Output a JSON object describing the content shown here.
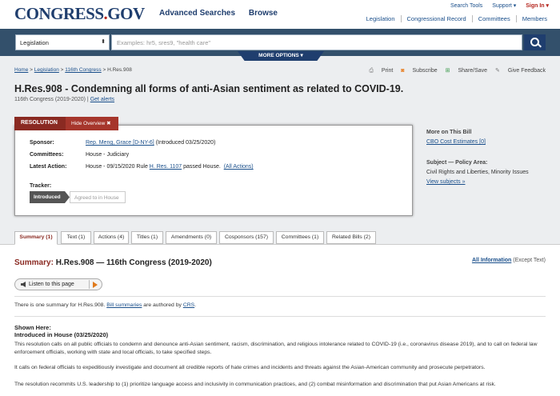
{
  "header": {
    "logo_main": "CONGRESS",
    "logo_dot": ".",
    "logo_gov": "GOV",
    "nav": [
      "Advanced Searches",
      "Browse"
    ],
    "util": [
      "Search Tools",
      "Support ▾",
      "Sign In ▾"
    ],
    "subnav": [
      "Legislation",
      "Congressional Record",
      "Committees",
      "Members"
    ]
  },
  "search": {
    "collection": "Legislation",
    "placeholder": "Examples: hr5, sres9, \"health care\"",
    "more_options": "MORE OPTIONS ▾"
  },
  "breadcrumb": {
    "items": [
      "Home",
      "Legislation",
      "116th Congress"
    ],
    "sep": " > ",
    "current": "H.Res.908"
  },
  "tools": [
    "Print",
    "Subscribe",
    "Share/Save",
    "Give Feedback"
  ],
  "bill": {
    "title": "H.Res.908 - Condemning all forms of anti-Asian sentiment as related to COVID-19.",
    "congress": "116th Congress (2019-2020)",
    "alerts": "Get alerts"
  },
  "overview": {
    "tab_label": "RESOLUTION",
    "hide_label": "Hide Overview ✖",
    "sponsor_label": "Sponsor:",
    "sponsor_link": "Rep. Meng, Grace [D-NY-6]",
    "sponsor_intro": "(Introduced 03/25/2020)",
    "committees_label": "Committees:",
    "committees": "House - Judiciary",
    "action_label": "Latest Action:",
    "action_text": "House - 09/15/2020 Rule",
    "action_link": "H. Res. 1107",
    "action_text2": "passed House.",
    "action_all": "(All Actions)",
    "tracker_label": "Tracker:",
    "tracker_steps": [
      "Introduced",
      "Agreed to in House"
    ]
  },
  "side": {
    "more_heading": "More on This Bill",
    "cbo_link": "CBO Cost Estimates [0]",
    "subject_heading": "Subject — Policy Area:",
    "subject": "Civil Rights and Liberties, Minority Issues",
    "view_subjects": "View subjects »"
  },
  "tabs": [
    "Summary (1)",
    "Text (1)",
    "Actions (4)",
    "Titles (1)",
    "Amendments (0)",
    "Cosponsors (157)",
    "Committees (1)",
    "Related Bills (2)"
  ],
  "summary": {
    "label": "Summary:",
    "title_rest": "H.Res.908 — 116th Congress (2019-2020)",
    "all_info": "All Information",
    "except_text": "(Except Text)",
    "listen": "Listen to this page",
    "one_summary_pre": "There is one summary for H.Res.908.",
    "bill_summaries_link": "Bill summaries",
    "authored_by": "are authored by",
    "crs_link": "CRS",
    "crs_end": ".",
    "shown_here": "Shown Here:",
    "introduced": "Introduced in House (03/25/2020)",
    "para1": "This resolution calls on all public officials to condemn and denounce anti-Asian sentiment, racism, discrimination, and religious intolerance related to COVID-19 (i.e., coronavirus disease 2019), and to call on federal law enforcement officials, working with state and local officials, to take specified steps.",
    "para2": "It calls on federal officials to expeditiously investigate and document all credible reports of hate crimes and incidents and threats against the Asian-American community and prosecute perpetrators.",
    "para3": "The resolution recommits U.S. leadership to (1) prioritize language access and inclusivity in communication practices, and (2) combat misinformation and discrimination that put Asian Americans at risk."
  }
}
